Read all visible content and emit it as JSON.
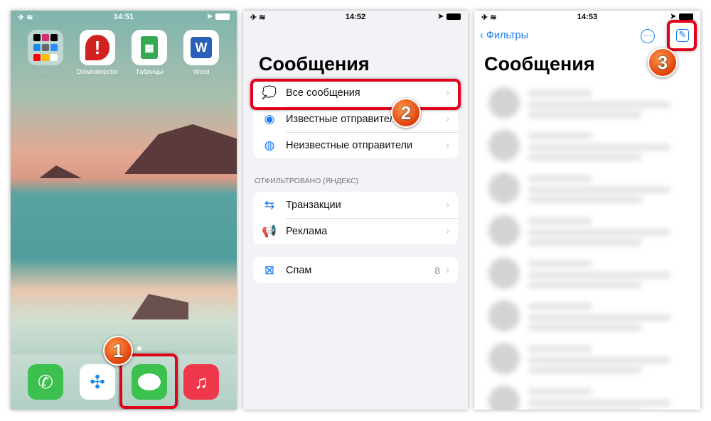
{
  "panel1": {
    "time": "14:51",
    "apps": [
      {
        "label": "-",
        "icon": "folder-icon"
      },
      {
        "label": "Downdetector",
        "icon": "exclamation-icon"
      },
      {
        "label": "Таблицы",
        "icon": "sheets-icon"
      },
      {
        "label": "Word",
        "icon": "word-icon",
        "glyph": "W"
      }
    ],
    "dock": [
      {
        "name": "phone",
        "glyph": "✆",
        "color": "#3cc14f"
      },
      {
        "name": "safari",
        "glyph": "✣",
        "color": "#1e88e5"
      },
      {
        "name": "messages",
        "glyph": "💬",
        "color": "#3cc14f"
      },
      {
        "name": "music",
        "glyph": "♫",
        "color": "#f0384c"
      }
    ],
    "step": "1"
  },
  "panel2": {
    "time": "14:52",
    "title": "Сообщения",
    "group1": [
      {
        "label": "Все сообщения",
        "icon": "chat-bubbles-icon"
      },
      {
        "label": "Известные отправители",
        "icon": "person-circle-icon"
      },
      {
        "label": "Неизвестные отправители",
        "icon": "unknown-person-icon"
      }
    ],
    "section": "ОТФИЛЬТРОВАНО (ЯНДЕКС)",
    "group2": [
      {
        "label": "Транзакции",
        "icon": "arrows-icon"
      },
      {
        "label": "Реклама",
        "icon": "megaphone-icon"
      }
    ],
    "group3": [
      {
        "label": "Спам",
        "icon": "spam-icon",
        "count": "8"
      }
    ],
    "step": "2"
  },
  "panel3": {
    "time": "14:53",
    "back": "Фильтры",
    "title": "Сообщения",
    "step": "3"
  }
}
